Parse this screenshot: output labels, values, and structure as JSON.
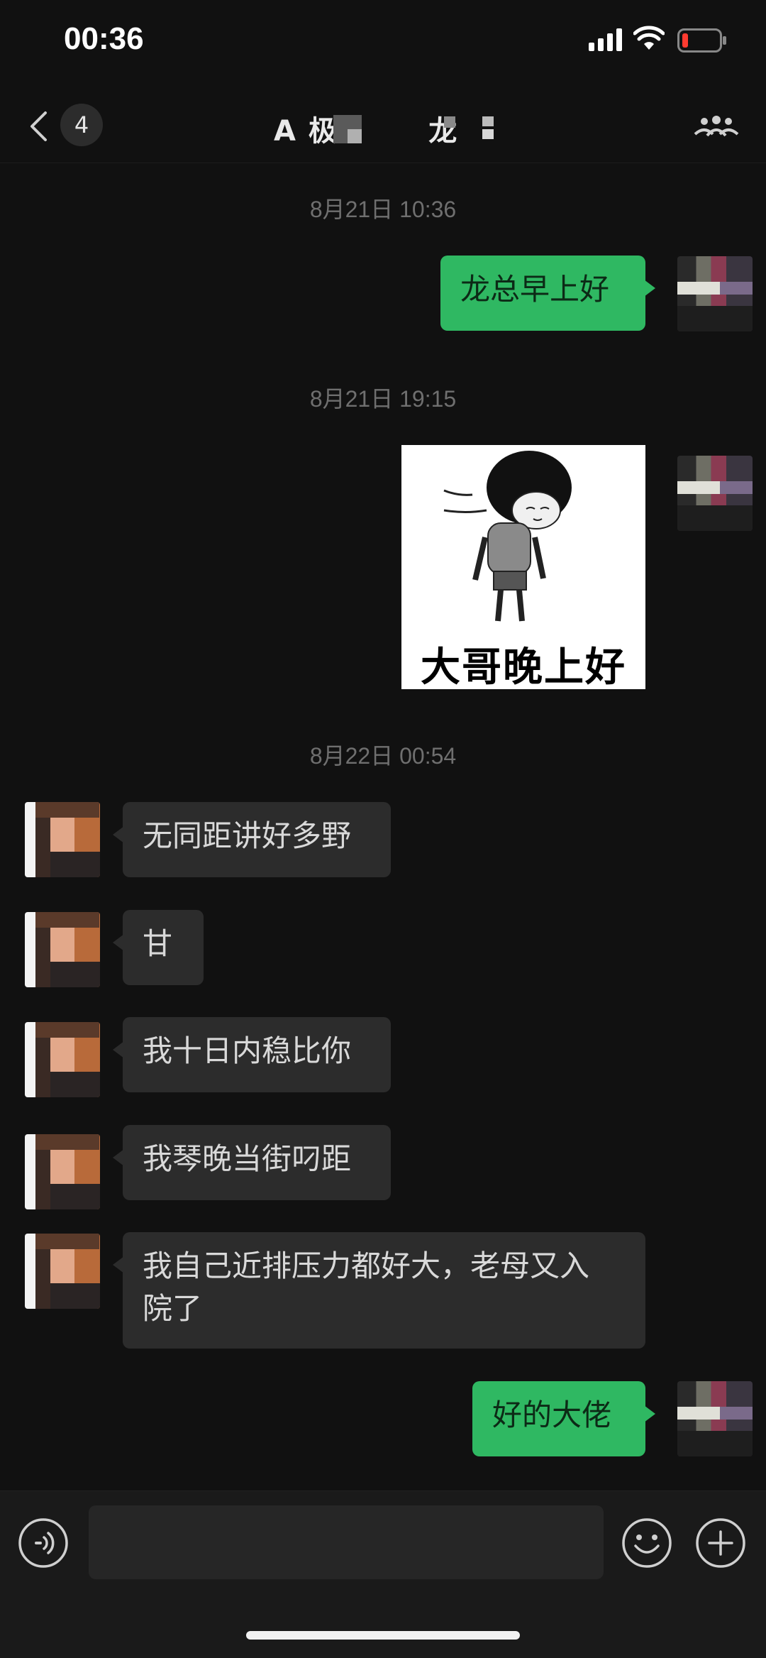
{
  "status_bar": {
    "time": "00:36"
  },
  "nav": {
    "unread_count": "4",
    "title": "A 极        龙",
    "back_icon": "chevron-left-icon",
    "more_icon": "more-people-icon"
  },
  "messages": {
    "ts1": "8月21日 10:36",
    "m1": "龙总早上好",
    "ts2": "8月21日 19:15",
    "sticker_caption": "大哥晚上好",
    "ts3": "8月22日 00:54",
    "m2": "无同距讲好多野",
    "m3": "甘",
    "m4": "我十日内稳比你",
    "m5": "我琴晚当街叼距",
    "m6a": "我自己近排压力都好大，老母又入",
    "m6b": "院了",
    "m7": "好的大佬"
  },
  "input_bar": {
    "placeholder": "",
    "voice_icon": "voice-icon",
    "emoji_icon": "emoji-icon",
    "plus_icon": "plus-icon"
  },
  "colors": {
    "background": "#111111",
    "sent_bubble": "#2fb862",
    "received_bubble": "#2c2c2c"
  }
}
